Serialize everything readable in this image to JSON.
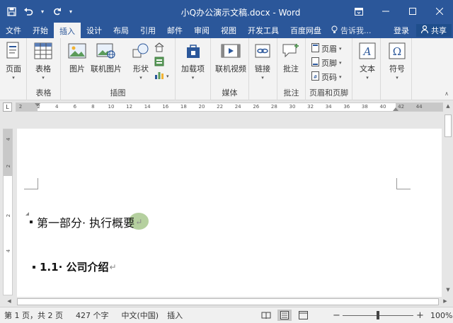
{
  "title_bar": {
    "title": "小Q办公演示文稿.docx - Word",
    "qat": {
      "save_icon": "save-icon",
      "undo_icon": "undo-icon",
      "redo_icon": "redo-icon",
      "customize_icon": "chevron-down-icon"
    },
    "controls": {
      "ribbon_display": "ribbon-display-icon",
      "minimize": "minimize-icon",
      "maximize": "maximize-icon",
      "close": "close-icon"
    }
  },
  "tabs": [
    "文件",
    "开始",
    "插入",
    "设计",
    "布局",
    "引用",
    "邮件",
    "审阅",
    "视图",
    "开发工具",
    "百度网盘"
  ],
  "active_tab": "插入",
  "tell_me": "告诉我...",
  "login": "登录",
  "share": "共享",
  "ribbon": {
    "groups": {
      "pages": {
        "label": "页面"
      },
      "tables": {
        "label": "表格",
        "button": "表格"
      },
      "illustrations": {
        "label": "插图",
        "picture": "图片",
        "online_picture": "联机图片",
        "shapes": "形状"
      },
      "addins": {
        "button": "加载项"
      },
      "media": {
        "label": "媒体",
        "online_video": "联机视频"
      },
      "links": {
        "button": "链接"
      },
      "comments": {
        "label": "批注",
        "button": "批注"
      },
      "header_footer": {
        "label": "页眉和页脚",
        "header": "页眉",
        "footer": "页脚",
        "page_number": "页码"
      },
      "text": {
        "button": "文本"
      },
      "symbols": {
        "button": "符号"
      }
    }
  },
  "ruler": {
    "tab_selector": "L",
    "ticks": [
      "2",
      "2",
      "4",
      "6",
      "8",
      "10",
      "12",
      "14",
      "16",
      "18",
      "20",
      "22",
      "24",
      "26",
      "28",
      "30",
      "32",
      "34",
      "36",
      "38",
      "40",
      "42",
      "44"
    ],
    "vticks": [
      "4",
      "2",
      "2",
      "4"
    ]
  },
  "document": {
    "heading1": "第一部分· 执行概要",
    "heading2": "1.1· 公司介绍",
    "pilcrow": "↵"
  },
  "status": {
    "page": "第 1 页，共 2 页",
    "words": "427 个字",
    "language": "中文(中国)",
    "mode": "插入",
    "zoom_minus": "−",
    "zoom_plus": "+",
    "zoom": "100%",
    "zoom_level_percent": 100
  }
}
